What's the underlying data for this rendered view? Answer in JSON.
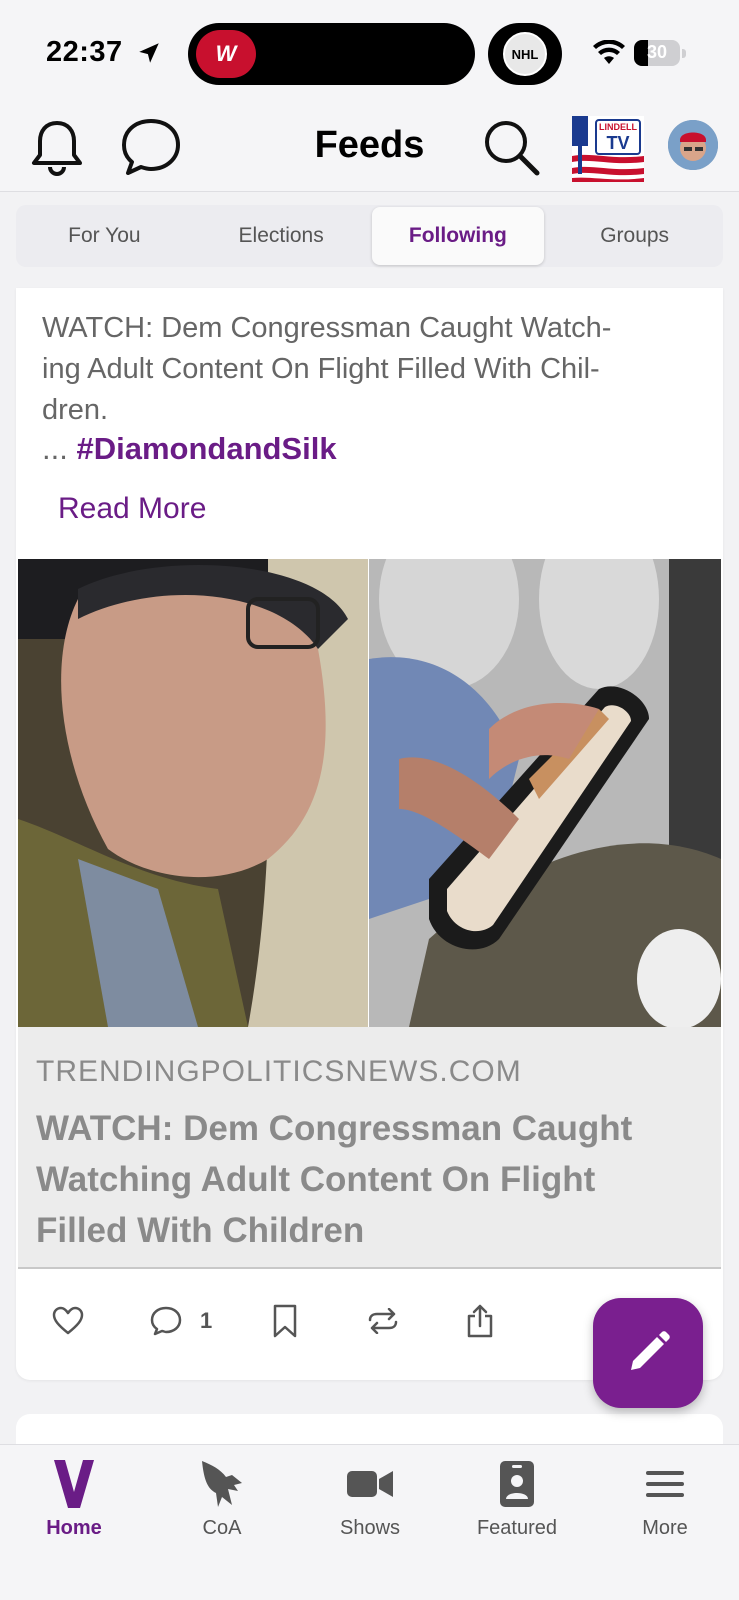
{
  "status_bar": {
    "time": "22:37",
    "battery": "30",
    "battery_level": 0.3
  },
  "header": {
    "title": "Feeds",
    "logo_text_top": "LINDELL",
    "logo_text_bottom": "TV"
  },
  "tabs": [
    {
      "label": "For You",
      "active": false
    },
    {
      "label": "Elections",
      "active": false
    },
    {
      "label": "Following",
      "active": true
    },
    {
      "label": "Groups",
      "active": false
    }
  ],
  "post": {
    "text_lines": [
      "WATCH: Dem Congressman Caught Watch-",
      "ing Adult Content On Flight Filled With Chil-",
      "dren."
    ],
    "ellipsis": "...",
    "hashtag": "#DiamondandSilk",
    "read_more": "Read More",
    "link": {
      "domain": "TRENDINGPOLITICSNEWS.COM",
      "title": "WATCH: Dem Congressman Caught Watching Adult Content On Flight Filled With Children"
    },
    "actions": {
      "comment_count": "1"
    }
  },
  "bottom_nav": [
    {
      "label": "Home",
      "icon": "v-logo-icon",
      "active": true
    },
    {
      "label": "CoA",
      "icon": "eagle-icon",
      "active": false
    },
    {
      "label": "Shows",
      "icon": "video-camera-icon",
      "active": false
    },
    {
      "label": "Featured",
      "icon": "id-badge-icon",
      "active": false
    },
    {
      "label": "More",
      "icon": "hamburger-menu-icon",
      "active": false
    }
  ],
  "colors": {
    "accent": "#6a1c86",
    "fab": "#7a1f8f"
  }
}
